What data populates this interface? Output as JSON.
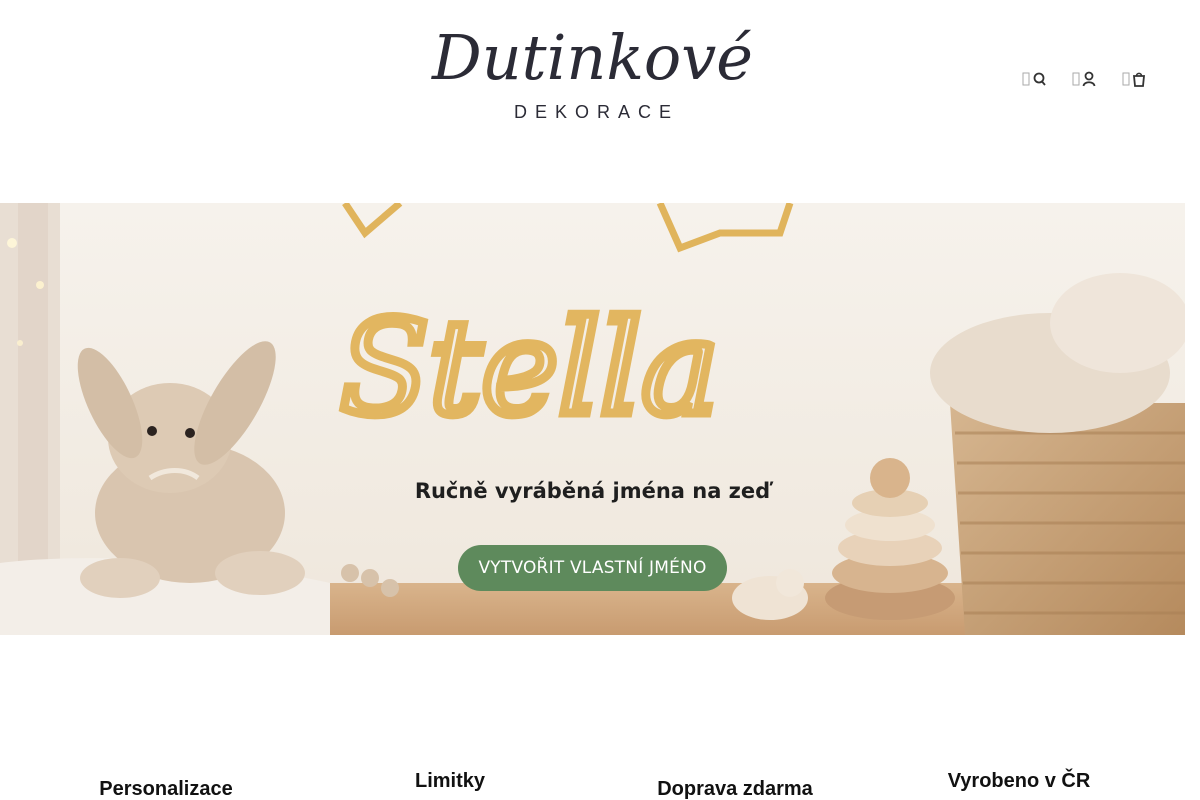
{
  "header": {
    "logo_script": "Dutinkové",
    "logo_sub": "DEKORACE",
    "icons": [
      "search-icon",
      "user-icon",
      "cart-icon"
    ]
  },
  "hero": {
    "tagline": "Ručně vyráběná jména na zeď",
    "cta_label": "VYTVOŘIT VLASTNÍ JMÉNO",
    "cta_color": "#5e8a5c",
    "name_art": "Stella"
  },
  "features": {
    "items": [
      {
        "label": "Personalizace"
      },
      {
        "label": "Limitky"
      },
      {
        "label": "Doprava zdarma"
      },
      {
        "label": "Vyrobeno v ČR"
      }
    ]
  }
}
